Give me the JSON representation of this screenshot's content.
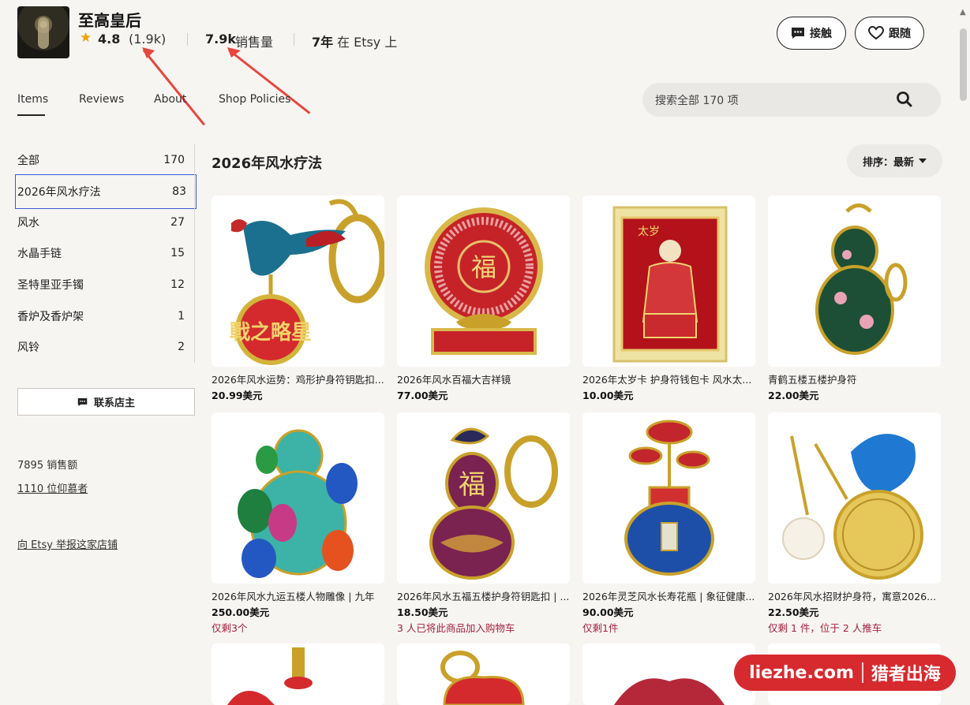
{
  "shop": {
    "name": "至高皇后",
    "rating": "4.8",
    "rating_count": "(1.9k)",
    "sales_num": "7.9k",
    "sales_label": "销售量",
    "years_num": "7年",
    "years_label": "在 Etsy 上"
  },
  "header": {
    "contact_label": "接触",
    "follow_label": "跟随"
  },
  "tabs": [
    "Items",
    "Reviews",
    "About",
    "Shop Policies"
  ],
  "search": {
    "placeholder": "搜索全部 170 项"
  },
  "sidebar": {
    "categories": [
      {
        "label": "全部",
        "count": "170"
      },
      {
        "label": "2026年风水疗法",
        "count": "83"
      },
      {
        "label": "风水",
        "count": "27"
      },
      {
        "label": "水晶手链",
        "count": "15"
      },
      {
        "label": "圣特里亚手镯",
        "count": "12"
      },
      {
        "label": "香炉及香炉架",
        "count": "1"
      },
      {
        "label": "风铃",
        "count": "2"
      }
    ],
    "contact_owner": "联系店主",
    "sales_total": "7895 销售额",
    "admirers": "1110 位仰慕者",
    "report": "向 Etsy 举报这家店铺"
  },
  "main": {
    "section_title": "2026年风水疗法",
    "sort_label": "排序：最新"
  },
  "products": [
    {
      "title": "2026年风水运势：鸡形护身符钥匙扣...",
      "price": "20.99美元",
      "note": ""
    },
    {
      "title": "2026年风水百福大吉祥镜",
      "price": "77.00美元",
      "note": ""
    },
    {
      "title": "2026年太岁卡 护身符钱包卡 风水太...",
      "price": "10.00美元",
      "note": ""
    },
    {
      "title": "青鹤五楼五楼护身符",
      "price": "22.00美元",
      "note": ""
    },
    {
      "title": "2026年风水九运五楼人物雕像 | 九年",
      "price": "250.00美元",
      "note": "仅剩3个"
    },
    {
      "title": "2026年风水五福五楼护身符钥匙扣 | ...",
      "price": "18.50美元",
      "note": "3 人已将此商品加入购物车"
    },
    {
      "title": "2026年灵芝风水长寿花瓶 | 象征健康...",
      "price": "90.00美元",
      "note": "仅剩1件"
    },
    {
      "title": "2026年风水招财护身符，寓意2026...",
      "price": "22.50美元",
      "note": "仅剩 1 件，位于 2 人推车"
    }
  ],
  "thumb_text": {
    "p1": "戰之略星",
    "p2": "福",
    "p3": "太岁",
    "p6": "福"
  },
  "watermark": {
    "left": "liezhe.com",
    "right": "猎者出海"
  },
  "colors": {
    "accent": "#3a5ad6",
    "star": "#f1a10a",
    "note_red": "#a3203b",
    "annotation": "#e8463d",
    "watermark": "#d72a2f"
  }
}
